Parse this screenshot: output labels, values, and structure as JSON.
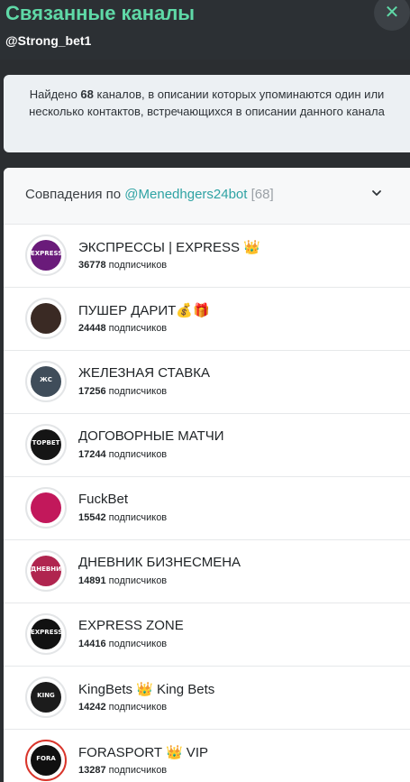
{
  "header": {
    "title": "Связанные каналы",
    "subtitle": "@Strong_bet1",
    "close_icon": "close-icon"
  },
  "notice": {
    "prefix": "Найдено ",
    "count": "68",
    "suffix": " каналов, в описании которых упоминаются один или несколько контактов, встречающихся в описании данного канала"
  },
  "match": {
    "label": "Совпадения по ",
    "contact": "@Menedhgers24bot",
    "count": "[68]"
  },
  "subscribers_suffix": " подписчиков",
  "channels": [
    {
      "name": "ЭКСПРЕССЫ | EXPRESS 👑",
      "subscribers": "36778",
      "avatar_color": "#6a1b7a",
      "avatar_text": "EXPRESS"
    },
    {
      "name": "ПУШЕР ДАРИТ💰🎁",
      "subscribers": "24448",
      "avatar_color": "#3a2a24",
      "avatar_text": ""
    },
    {
      "name": "ЖЕЛЕЗНАЯ СТАВКА",
      "subscribers": "17256",
      "avatar_color": "#3f4d5a",
      "avatar_text": "ЖС"
    },
    {
      "name": "ДОГОВОРНЫЕ МАТЧИ",
      "subscribers": "17244",
      "avatar_color": "#151515",
      "avatar_text": "TOPBET"
    },
    {
      "name": "FuckBet",
      "subscribers": "15542",
      "avatar_color": "#c2185b",
      "avatar_text": ""
    },
    {
      "name": "ДНЕВНИК БИЗНЕСМЕНА",
      "subscribers": "14891",
      "avatar_color": "#b0254f",
      "avatar_text": "ДНЕВНИК"
    },
    {
      "name": "EXPRESS ZONE",
      "subscribers": "14416",
      "avatar_color": "#111111",
      "avatar_text": "EXPRESS"
    },
    {
      "name": "KingBets 👑 King Bets",
      "subscribers": "14242",
      "avatar_color": "#1c1c1c",
      "avatar_text": "KING"
    },
    {
      "name": "FORASPORT 👑 VIP",
      "subscribers": "13287",
      "avatar_color": "#101010",
      "avatar_text": "FORA"
    }
  ]
}
